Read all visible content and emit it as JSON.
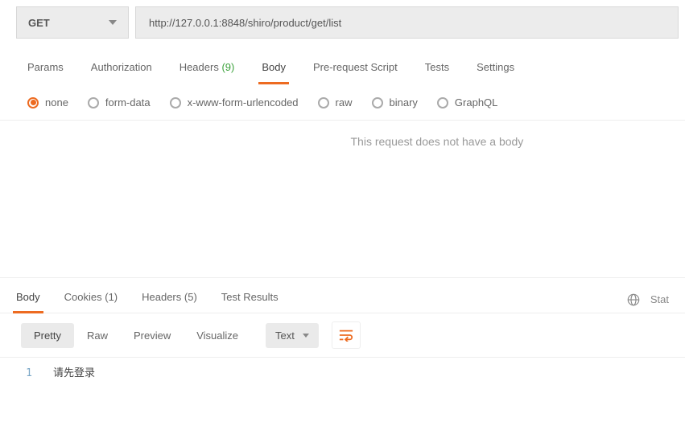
{
  "request": {
    "method": "GET",
    "url": "http://127.0.0.1:8848/shiro/product/get/list"
  },
  "tabs": {
    "params": "Params",
    "authorization": "Authorization",
    "headers_label": "Headers",
    "headers_count": "(9)",
    "body": "Body",
    "prerequest": "Pre-request Script",
    "tests": "Tests",
    "settings": "Settings"
  },
  "bodyTypes": {
    "none": "none",
    "formdata": "form-data",
    "urlencoded": "x-www-form-urlencoded",
    "raw": "raw",
    "binary": "binary",
    "graphql": "GraphQL"
  },
  "noBodyMessage": "This request does not have a body",
  "responseTabs": {
    "body": "Body",
    "cookies_label": "Cookies",
    "cookies_count": "(1)",
    "headers_label": "Headers",
    "headers_count": "(5)",
    "testresults": "Test Results",
    "status_label": "Stat"
  },
  "formatBar": {
    "pretty": "Pretty",
    "raw": "Raw",
    "preview": "Preview",
    "visualize": "Visualize",
    "formatType": "Text"
  },
  "responseBody": {
    "lineNum": "1",
    "content": "请先登录"
  }
}
